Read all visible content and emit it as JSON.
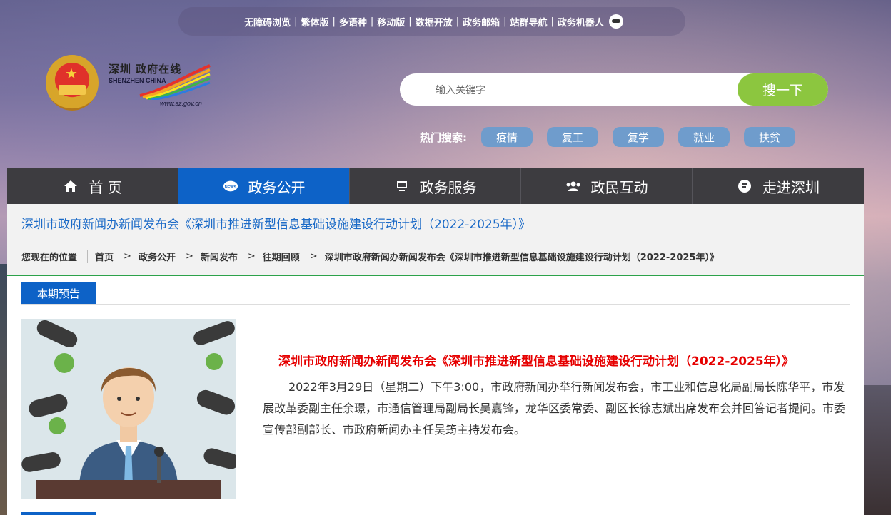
{
  "top_links": [
    "无障碍浏览",
    "繁体版",
    "多语种",
    "移动版",
    "数据开放",
    "政务邮箱",
    "站群导航",
    "政务机器人"
  ],
  "logo": {
    "cn": "深圳 政府在线",
    "en": "SHENZHEN CHINA",
    "url": "www.sz.gov.cn"
  },
  "search": {
    "placeholder": "输入关键字",
    "button": "搜一下"
  },
  "hot": {
    "label": "热门搜索:",
    "tags": [
      "疫情",
      "复工",
      "复学",
      "就业",
      "扶贫"
    ]
  },
  "nav": [
    {
      "label": "首 页",
      "icon": "home-icon"
    },
    {
      "label": "政务公开",
      "icon": "news-icon"
    },
    {
      "label": "政务服务",
      "icon": "monitor-icon"
    },
    {
      "label": "政民互动",
      "icon": "people-icon"
    },
    {
      "label": "走进深圳",
      "icon": "chat-icon"
    }
  ],
  "page_title": "深圳市政府新闻办新闻发布会《深圳市推进新型信息基础设施建设行动计划（2022-2025年）》",
  "breadcrumb": {
    "label": "您现在的位置",
    "items": [
      "首页",
      "政务公开",
      "新闻发布",
      "往期回顾",
      "深圳市政府新闻办新闻发布会《深圳市推进新型信息基础设施建设行动计划（2022-2025年）》"
    ],
    "separator": ">"
  },
  "section": {
    "tab": "本期预告"
  },
  "article": {
    "title": "深圳市政府新闻办新闻发布会《深圳市推进新型信息基础设施建设行动计划（2022-2025年）》",
    "body": "2022年3月29日（星期二）下午3:00，市政府新闻办举行新闻发布会，市工业和信息化局副局长陈华平，市发展改革委副主任余璟，市通信管理局副局长吴嘉锋，龙华区委常委、副区长徐志斌出席发布会并回答记者提问。市委宣传部副部长、市政府新闻办主任吴筠主持发布会。"
  },
  "colors": {
    "nav_active": "#0d62c7",
    "search_button": "#8cc63f",
    "hot_tag": "#6f9ccc",
    "title_link": "#1b6ac7",
    "article_title": "#e60000"
  }
}
